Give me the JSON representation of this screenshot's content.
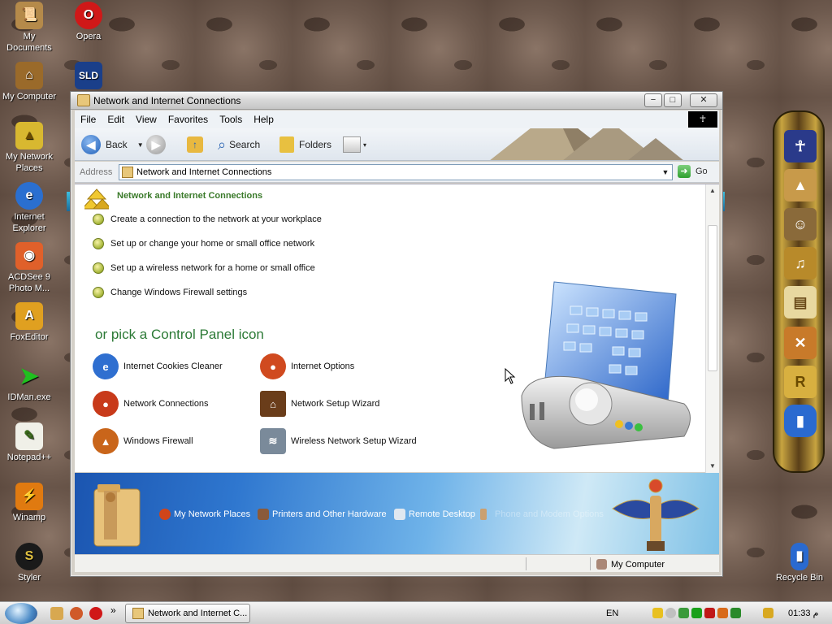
{
  "desktop": {
    "icons": [
      {
        "label": "My Documents"
      },
      {
        "label": "Opera"
      },
      {
        "label": "SLD"
      },
      {
        "label": "My Computer"
      },
      {
        "label": "My Network Places"
      },
      {
        "label": "Internet Explorer"
      },
      {
        "label": "ACDSee 9 Photo M..."
      },
      {
        "label": "FoxEditor"
      },
      {
        "label": "IDMan.exe"
      },
      {
        "label": "Notepad++"
      },
      {
        "label": "Winamp"
      },
      {
        "label": "Styler"
      },
      {
        "label": "Recycle Bin"
      }
    ]
  },
  "window": {
    "title": "Network and Internet Connections",
    "controls": {
      "minimize": "−",
      "maximize": "□",
      "close": "✕"
    },
    "menu": [
      "File",
      "Edit",
      "View",
      "Favorites",
      "Tools",
      "Help"
    ],
    "toolbar": {
      "back": "Back",
      "search": "Search",
      "folders": "Folders"
    },
    "address": {
      "label": "Address",
      "value": "Network and Internet Connections",
      "go": "Go"
    },
    "content": {
      "heading": "Network and Internet Connections",
      "tasks": [
        "Create a connection to the network at your workplace",
        "Set up or change your home or small office network",
        "Set up a wireless network for a home or small office",
        "Change Windows Firewall settings"
      ],
      "pick_title": "or pick a Control Panel icon",
      "cp_icons": [
        {
          "label": "Internet Cookies Cleaner",
          "icon": "ie-icon",
          "color": "#2f6fd0"
        },
        {
          "label": "Internet Options",
          "icon": "globe-icon",
          "color": "#d04a1f"
        },
        {
          "label": "Network Connections",
          "icon": "network-globe-icon",
          "color": "#c83a1a"
        },
        {
          "label": "Network Setup Wizard",
          "icon": "house-icon",
          "color": "#6a3d1a"
        },
        {
          "label": "Windows Firewall",
          "icon": "firewall-icon",
          "color": "#c9651a"
        },
        {
          "label": "Wireless Network Setup Wizard",
          "icon": "wireless-icon",
          "color": "#7a8a9a"
        }
      ]
    },
    "banner_links": [
      {
        "label": "My Network Places",
        "color": "#d0451a"
      },
      {
        "label": "Printers and Other Hardware",
        "color": "#8a5a3a"
      },
      {
        "label": "Remote Desktop",
        "color": "#e0e8f0"
      },
      {
        "label": "Phone and Modem Options",
        "color": "#caa070"
      }
    ],
    "status": {
      "zone": "My Computer"
    }
  },
  "taskbar": {
    "task_button": "Network and Internet C...",
    "language": "EN",
    "clock": "01:33 م",
    "chevron": "»"
  }
}
